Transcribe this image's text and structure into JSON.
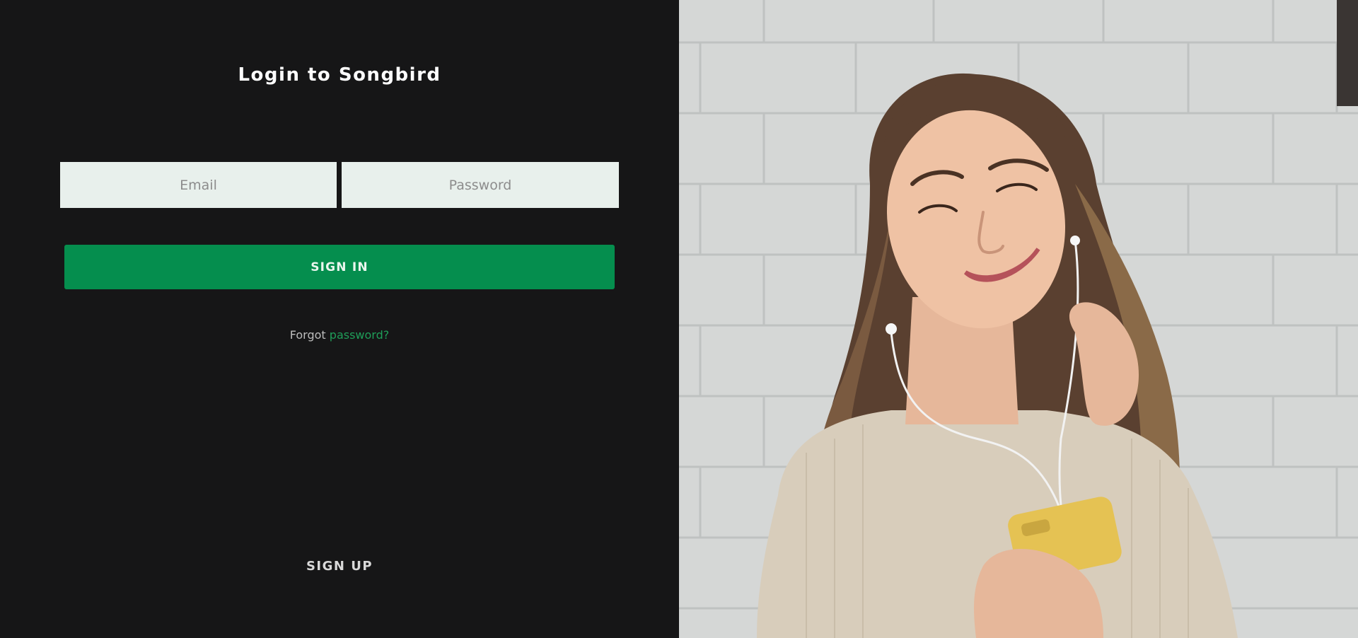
{
  "login": {
    "title": "Login to Songbird",
    "email_placeholder": "Email",
    "password_placeholder": "Password",
    "signin_label": "SIGN IN",
    "forgot_prefix": "Forgot",
    "forgot_link": "password?",
    "signup_label": "SIGN UP"
  },
  "colors": {
    "background": "#161617",
    "accent": "#058e4e",
    "field_bg": "#e8f0ec",
    "link": "#1f9e59"
  },
  "hero_image": {
    "icon": "woman-with-earphones-photo"
  }
}
